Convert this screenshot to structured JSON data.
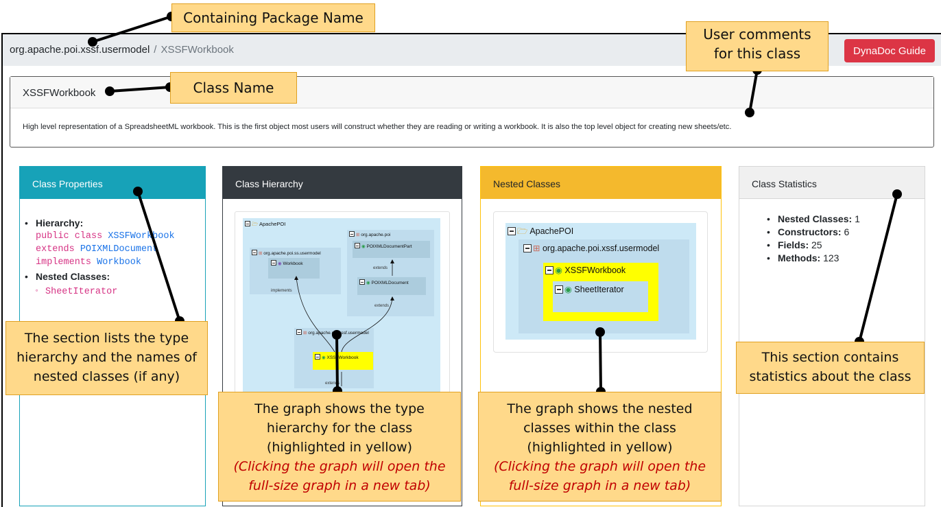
{
  "breadcrumb": {
    "package": "org.apache.poi.xssf.usermodel",
    "separator": "/",
    "current": "XSSFWorkbook"
  },
  "guide_button": {
    "label": "DynaDoc Guide",
    "color": "#dc3545"
  },
  "class_card": {
    "title": "XSSFWorkbook",
    "description": "High level representation of a SpreadsheetML workbook. This is the first object most users will construct whether they are reading or writing a workbook. It is also the top level object for creating new sheets/etc."
  },
  "panels": {
    "properties": {
      "title": "Class Properties",
      "hierarchy_label": "Hierarchy:",
      "kw_public_class": "public class",
      "class_name": "XSSFWorkbook",
      "kw_extends": "extends",
      "superclass": "POIXMLDocument",
      "kw_implements": "implements",
      "interface": "Workbook",
      "nested_label": "Nested Classes:",
      "nested": [
        "SheetIterator"
      ]
    },
    "hierarchy": {
      "title": "Class Hierarchy"
    },
    "nested": {
      "title": "Nested Classes"
    },
    "statistics": {
      "title": "Class Statistics",
      "items": [
        {
          "label": "Nested Classes:",
          "value": "1"
        },
        {
          "label": "Constructors:",
          "value": "6"
        },
        {
          "label": "Fields:",
          "value": "25"
        },
        {
          "label": "Methods:",
          "value": "123"
        }
      ]
    }
  },
  "hierarchy_graph": {
    "root": "ApachePOI",
    "pkg_ss": "org.apache.poi.ss.usermodel",
    "workbook": "Workbook",
    "pkg_poi": "org.apache.poi",
    "poixml_part": "POIXMLDocumentPart",
    "poixml_doc": "POIXMLDocument",
    "pkg_xssf": "org.apache.poi.xssf.usermodel",
    "xssf": "XSSFWorkbook",
    "label_extends": "extends",
    "label_implements": "implements"
  },
  "nested_graph": {
    "root": "ApachePOI",
    "pkg": "org.apache.poi.xssf.usermodel",
    "cls": "XSSFWorkbook",
    "nested": "SheetIterator"
  },
  "callouts": {
    "package_name": "Containing Package Name",
    "user_comments": "User comments for this class",
    "class_name": "Class Name",
    "props_desc": "The section lists the type hierarchy and the names of nested classes (if any)",
    "hier_desc": "The graph shows the type hierarchy for the class (highlighted in yellow)",
    "hier_note": "(Clicking the graph will open the full-size graph in a new tab)",
    "nested_desc": "The graph shows the nested classes within the class (highlighted in yellow)",
    "nested_note": "(Clicking the graph will open the full-size graph in a new tab)",
    "stats_desc": "This section contains statistics about the class"
  },
  "colors": {
    "highlight": "#ffff00",
    "callout": "#ffd98a",
    "info": "#17a2b8",
    "dark": "#343a40",
    "warning": "#f4b92d"
  }
}
